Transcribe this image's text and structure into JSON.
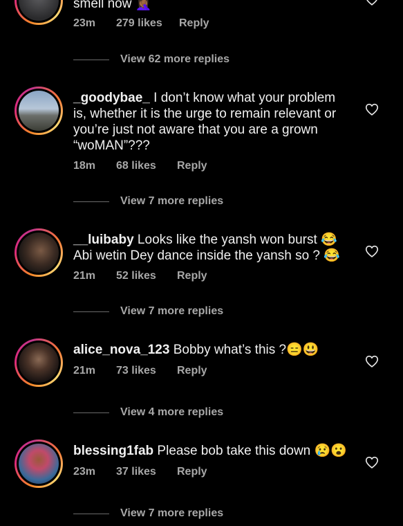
{
  "comments": [
    {
      "username": "",
      "text": "smell now 🤦🏾‍♀️",
      "time": "23m",
      "likes": "279 likes",
      "reply": "Reply",
      "view_replies": "View 62 more replies"
    },
    {
      "username": "_goodybae_",
      "text": " I don’t know what your problem is, whether it is the urge to remain relevant or you’re just not aware that you are a grown “woMAN”???",
      "time": "18m",
      "likes": "68 likes",
      "reply": "Reply",
      "view_replies": "View 7 more replies"
    },
    {
      "username": "__luibaby",
      "text": " Looks like the yansh won burst 😂 Abi wetin Dey dance inside the yansh so ? 😂",
      "time": "21m",
      "likes": "52 likes",
      "reply": "Reply",
      "view_replies": "View 7 more replies"
    },
    {
      "username": "alice_nova_123",
      "text": " Bobby what’s this ?😑😃",
      "time": "21m",
      "likes": "73 likes",
      "reply": "Reply",
      "view_replies": "View 4 more replies"
    },
    {
      "username": "blessing1fab",
      "text": " Please bob take this down 😢😮",
      "time": "23m",
      "likes": "37 likes",
      "reply": "Reply",
      "view_replies": "View 7 more replies"
    }
  ],
  "icons": {
    "like": "heart-outline-icon",
    "avatar_ring": "story-ring"
  },
  "colors": {
    "background": "#000000",
    "text": "#f0f0f0",
    "muted": "#a8a8a8"
  }
}
